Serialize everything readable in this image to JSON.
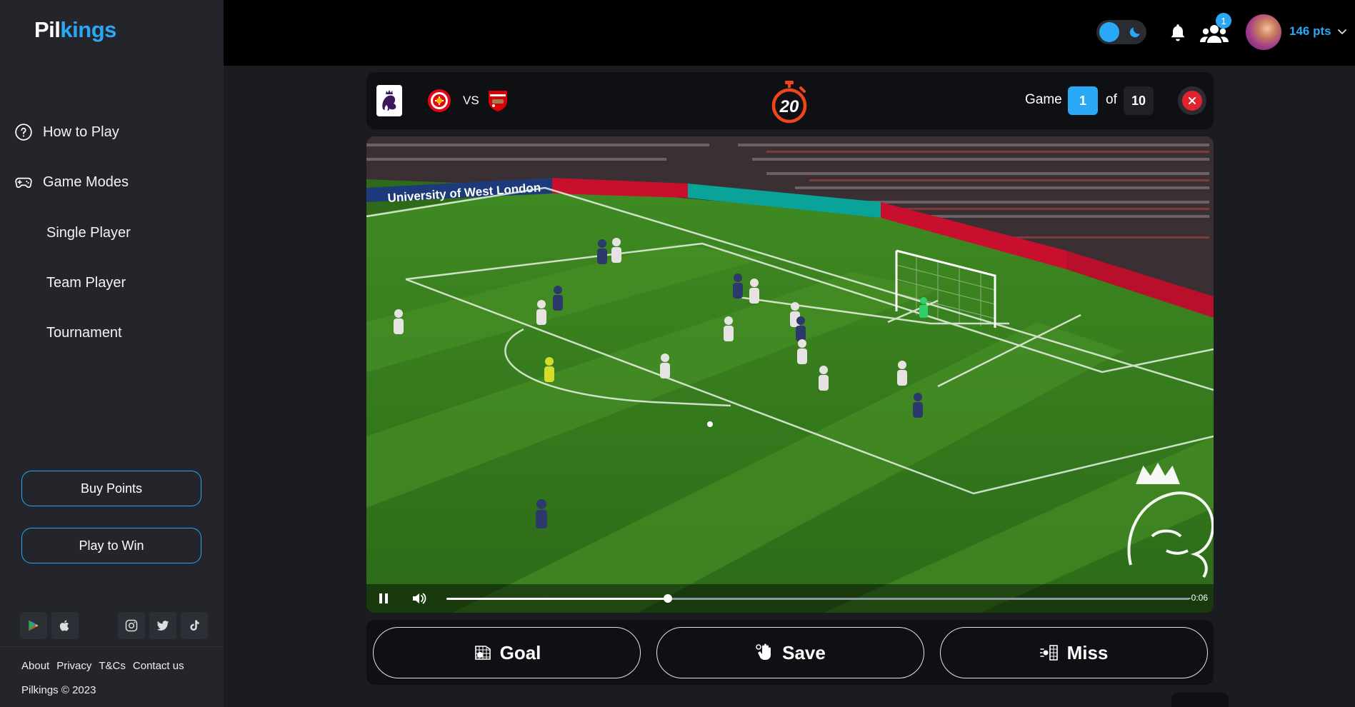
{
  "app": {
    "logo_part1": "Pil",
    "logo_part2": "kings"
  },
  "sidebar": {
    "nav": [
      {
        "label": "How to Play",
        "icon": "help-circle-icon"
      },
      {
        "label": "Game Modes",
        "icon": "gamepad-icon"
      }
    ],
    "game_modes": [
      "Single Player",
      "Team Player",
      "Tournament"
    ],
    "buttons": {
      "buy_points": "Buy Points",
      "play_to_win": "Play to Win"
    },
    "stores": [
      "google-play-icon",
      "apple-icon"
    ],
    "socials": [
      "instagram-icon",
      "twitter-icon",
      "tiktok-icon"
    ],
    "footer_links": [
      "About",
      "Privacy",
      "T&Cs",
      "Contact us"
    ],
    "copyright": "Pilkings © 2023"
  },
  "topbar": {
    "theme": "dark",
    "notifications_badge": "1",
    "points": "146 pts"
  },
  "game": {
    "league": "premier-league-logo",
    "home": "brentford-crest",
    "vs": "VS",
    "away": "arsenal-crest",
    "timer": "20",
    "game_label": "Game",
    "current": "1",
    "of_label": "of",
    "total": "10"
  },
  "video": {
    "overlay_text": "University of West London",
    "progress": 0.298,
    "time_remaining": "-0:06",
    "state": "playing"
  },
  "actions": {
    "goal": "Goal",
    "save": "Save",
    "miss": "Miss"
  },
  "colors": {
    "accent": "#2aa8f5",
    "sidebar_bg": "#23252b",
    "close_red": "#e0242b",
    "timer_orange": "#f0441a"
  }
}
